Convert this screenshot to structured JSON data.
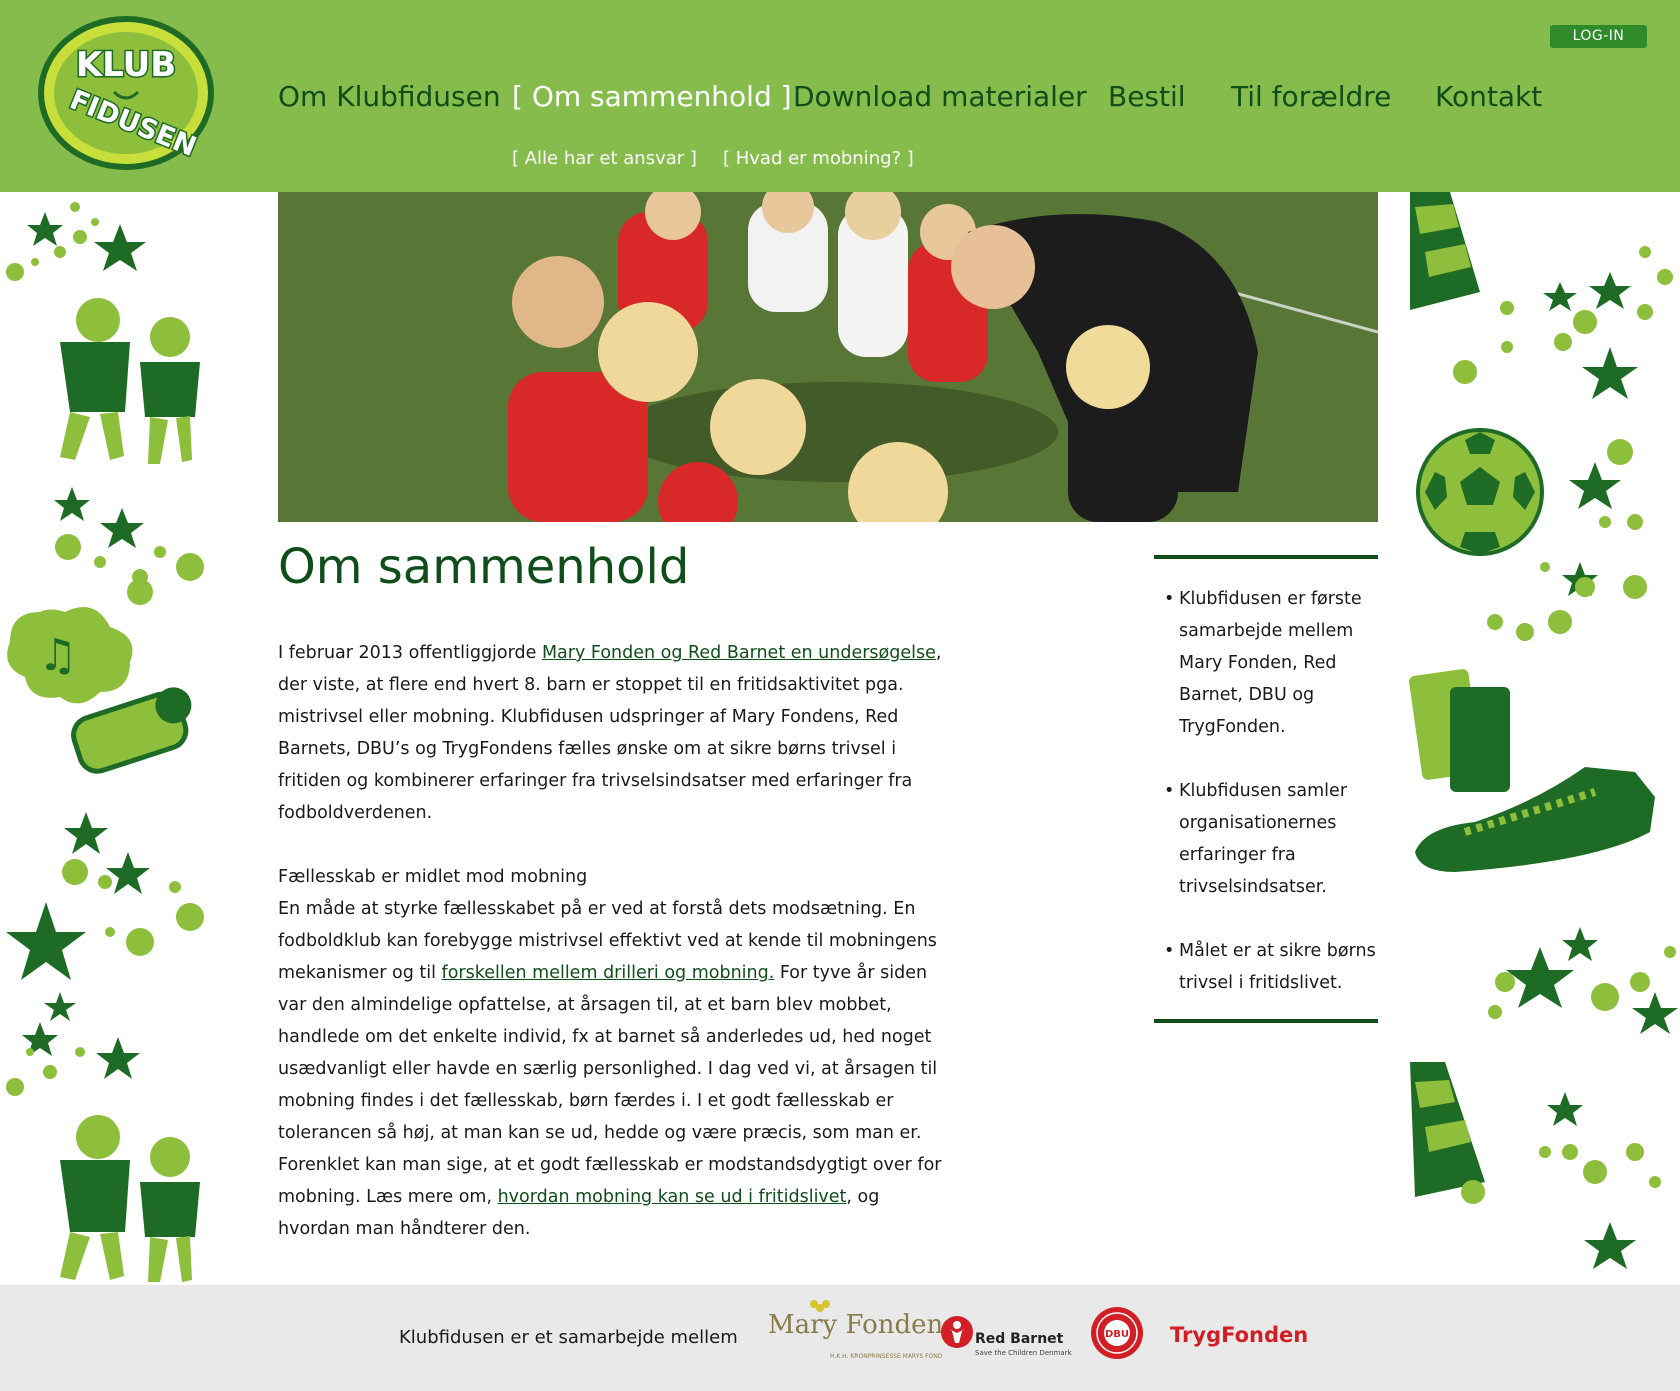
{
  "header": {
    "logo_text_top": "KLUB",
    "logo_text_bottom": "FIDUSEN",
    "login_label": "LOG-IN",
    "nav": [
      {
        "label": "Om Klubfidusen"
      },
      {
        "label": "[ Om sammenhold ]"
      },
      {
        "label": "Download materialer"
      },
      {
        "label": "Bestil"
      },
      {
        "label": "Til forældre"
      },
      {
        "label": "Kontakt"
      }
    ],
    "subnav": [
      {
        "label": "[ Alle har et ansvar ]"
      },
      {
        "label": "[ Hvad er mobning? ]"
      }
    ]
  },
  "colors": {
    "header_bg": "#85bc4b",
    "dark_green": "#0f4d1a",
    "login_bg": "#2f8a2a",
    "footer_bg": "#e9e9e9"
  },
  "main": {
    "title": "Om sammenhold",
    "p1_before": "I februar 2013 offentliggjorde ",
    "p1_link": "Mary Fonden og Red Barnet en undersøgelse",
    "p1_after": ", der viste, at flere end hvert 8. barn er stoppet til en fritidsaktivitet pga. mistrivsel eller mobning. Klubfidusen udspringer af Mary Fondens, Red Barnets, DBU’s og TrygFondens fælles ønske om at sikre børns trivsel i fritiden og kombinerer erfaringer fra trivselsindsatser med erfaringer fra fodboldverdenen.",
    "p2_heading": "Fællesskab er midlet mod mobning",
    "p2_a": "En måde at styrke fællesskabet på er ved at forstå dets modsætning. En fodboldklub kan forebygge mistrivsel effektivt ved at kende til mobningens mekanismer og til ",
    "p2_link1": "forskellen mellem drilleri og mobning.",
    "p2_b": " For tyve år siden var den almindelige opfattelse, at årsagen til, at et barn blev mobbet, handlede om det enkelte individ, fx at barnet så anderledes ud, hed noget usædvanligt eller havde en særlig personlighed. I dag ved vi, at årsagen til mobning findes i det fællesskab, børn færdes i. I et godt fællesskab er tolerancen så høj, at man kan se ud, hedde og være præcis, som man er. Forenklet kan man sige, at et godt fællesskab er modstandsdygtigt over for mobning. Læs mere om, ",
    "p2_link2": "hvordan mobning kan se ud i fritidslivet",
    "p2_c": ", og hvordan man håndterer den."
  },
  "sidebar": {
    "items": [
      "Klubfidusen er første samarbejde mellem Mary Fonden, Red Barnet, DBU og TrygFonden.",
      "Klubfidusen samler organisationernes erfaringer fra trivselsindsatser.",
      "Målet er at sikre børns trivsel i fritidslivet."
    ]
  },
  "footer": {
    "text": "Klubfidusen er et samarbejde mellem",
    "partners": {
      "mary": "Mary Fonden",
      "mary_sub": "H.K.H. KRONPRINSESSE MARYS FOND",
      "red": "Red Barnet",
      "red_sub": "Save the Children Denmark",
      "dbu": "DBU",
      "tryg": "TrygFonden"
    }
  }
}
